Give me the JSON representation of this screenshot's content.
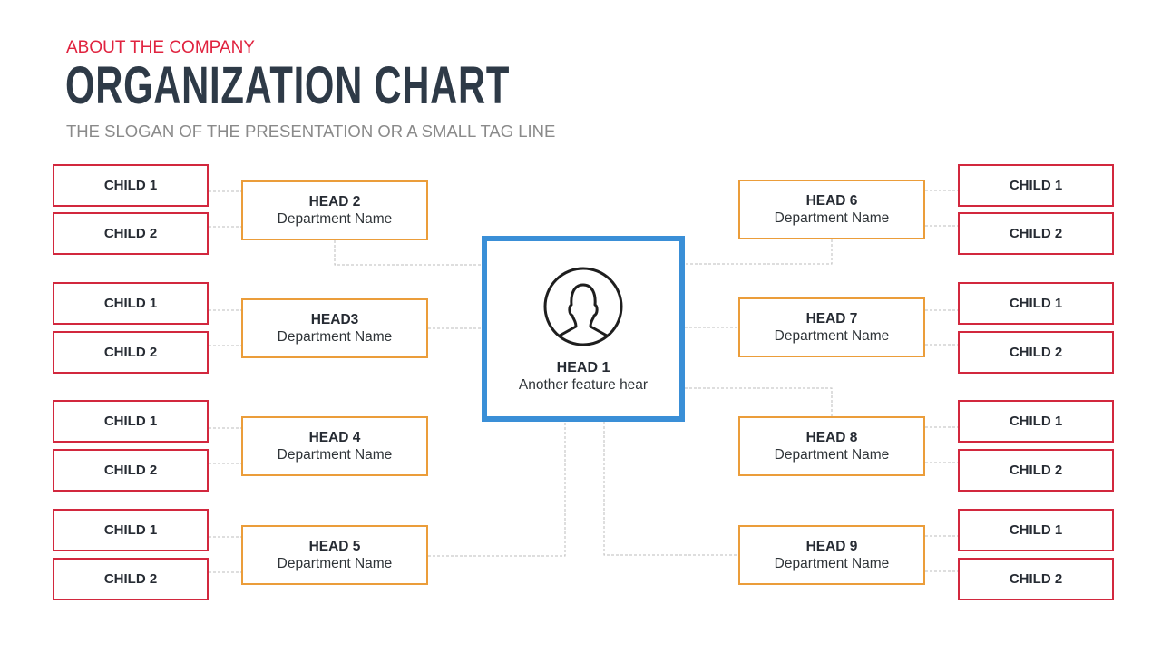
{
  "header": {
    "eyebrow": "ABOUT THE COMPANY",
    "title": "ORGANIZATION CHART",
    "tagline": "THE SLOGAN OF THE PRESENTATION OR A SMALL TAG LINE"
  },
  "colors": {
    "eyebrow": "#e0233f",
    "title": "#2e3a47",
    "center_border": "#3a8fd7",
    "head_border": "#eb9d3a",
    "child_border": "#d2283e",
    "connector": "#bdbdbd"
  },
  "center": {
    "icon": "user-avatar-icon",
    "title": "HEAD 1",
    "subtitle": "Another feature hear"
  },
  "heads": [
    {
      "title": "HEAD 2",
      "subtitle": "Department Name",
      "side": "left",
      "children": [
        "CHILD 1",
        "CHILD 2"
      ]
    },
    {
      "title": "HEAD3",
      "subtitle": "Department Name",
      "side": "left",
      "children": [
        "CHILD 1",
        "CHILD 2"
      ]
    },
    {
      "title": "HEAD 4",
      "subtitle": "Department Name",
      "side": "left",
      "children": [
        "CHILD 1",
        "CHILD 2"
      ]
    },
    {
      "title": "HEAD 5",
      "subtitle": "Department Name",
      "side": "left",
      "children": [
        "CHILD 1",
        "CHILD 2"
      ]
    },
    {
      "title": "HEAD 6",
      "subtitle": "Department Name",
      "side": "right",
      "children": [
        "CHILD 1",
        "CHILD 2"
      ]
    },
    {
      "title": "HEAD 7",
      "subtitle": "Department Name",
      "side": "right",
      "children": [
        "CHILD 1",
        "CHILD 2"
      ]
    },
    {
      "title": "HEAD 8",
      "subtitle": "Department Name",
      "side": "right",
      "children": [
        "CHILD 1",
        "CHILD 2"
      ]
    },
    {
      "title": "HEAD 9",
      "subtitle": "Department Name",
      "side": "right",
      "children": [
        "CHILD 1",
        "CHILD 2"
      ]
    }
  ]
}
